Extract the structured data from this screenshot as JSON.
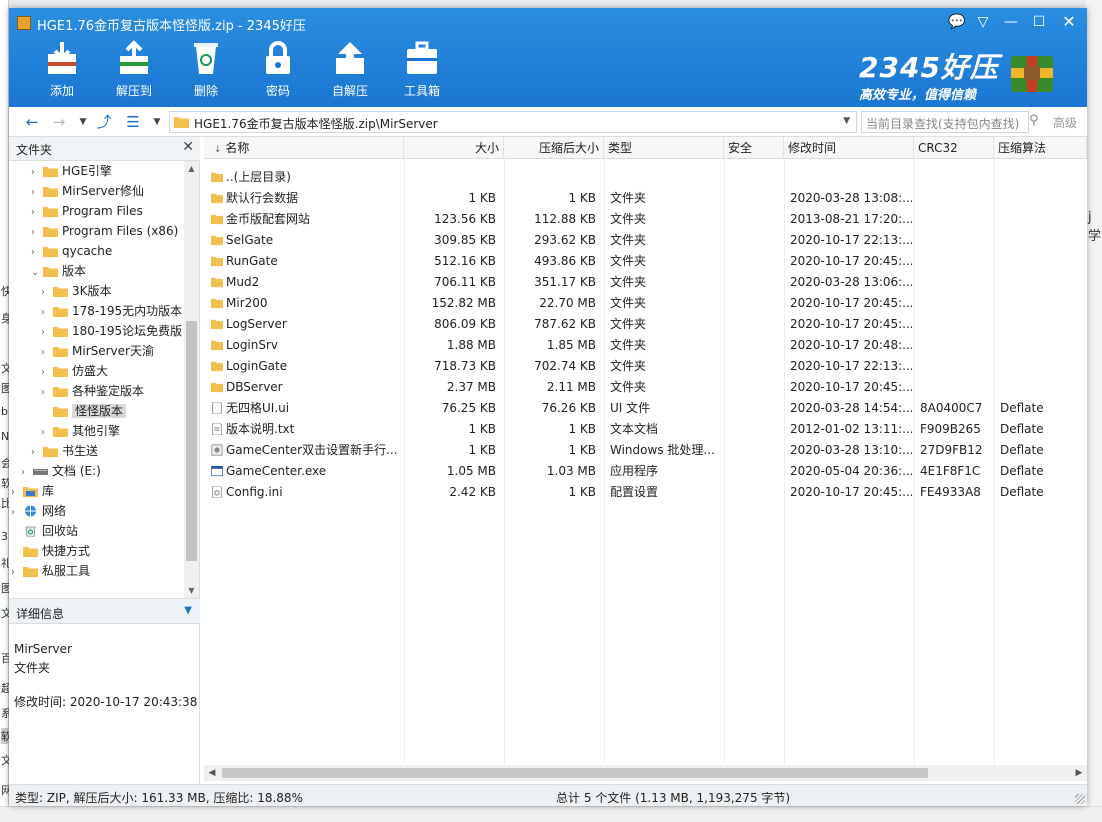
{
  "window": {
    "title": "HGE1.76金币复古版本怪怪版.zip - 2345好压",
    "controls": [
      "feedback-icon",
      "menu-icon",
      "minimize-icon",
      "maximize-icon",
      "close-icon"
    ]
  },
  "toolbar": {
    "items": [
      {
        "label": "添加",
        "icon": "add-archive-icon"
      },
      {
        "label": "解压到",
        "icon": "extract-icon"
      },
      {
        "label": "删除",
        "icon": "recycle-bin-icon"
      },
      {
        "label": "密码",
        "icon": "lock-icon"
      },
      {
        "label": "自解压",
        "icon": "self-extract-icon"
      },
      {
        "label": "工具箱",
        "icon": "toolbox-icon"
      }
    ]
  },
  "brand": {
    "name": "2345好压",
    "slogan": "高效专业，值得信赖"
  },
  "nav": {
    "path": "HGE1.76金币复古版本怪怪版.zip\\MirServer",
    "search_placeholder": "当前目录查找(支持包内查找)",
    "advanced_label": "高级"
  },
  "folder_pane": {
    "title": "文件夹",
    "items": [
      {
        "label": "HGE引擎",
        "level": 3,
        "arrow": "›"
      },
      {
        "label": "MirServer修仙",
        "level": 3,
        "arrow": "›"
      },
      {
        "label": "Program Files",
        "level": 3,
        "arrow": "›"
      },
      {
        "label": "Program Files (x86)",
        "level": 3,
        "arrow": "›"
      },
      {
        "label": "qycache",
        "level": 3,
        "arrow": "›"
      },
      {
        "label": "版本",
        "level": 3,
        "arrow": "⌄"
      },
      {
        "label": "3K版本",
        "level": 4,
        "arrow": "›"
      },
      {
        "label": "178-195无内功版本",
        "level": 4,
        "arrow": "›"
      },
      {
        "label": "180-195论坛免费版",
        "level": 4,
        "arrow": "›"
      },
      {
        "label": "MirServer天渝",
        "level": 4,
        "arrow": "›"
      },
      {
        "label": "仿盛大",
        "level": 4,
        "arrow": "›"
      },
      {
        "label": "各种鉴定版本",
        "level": 4,
        "arrow": "›"
      },
      {
        "label": "怪怪版本",
        "level": 4,
        "arrow": "",
        "selected": true
      },
      {
        "label": "其他引擎",
        "level": 4,
        "arrow": "›"
      },
      {
        "label": "书生送",
        "level": 3,
        "arrow": "›"
      },
      {
        "label": "文档 (E:)",
        "level": 2,
        "arrow": "›",
        "icon": "drive"
      },
      {
        "label": "库",
        "level": 1,
        "arrow": "›",
        "icon": "library"
      },
      {
        "label": "网络",
        "level": 1,
        "arrow": "›",
        "icon": "network"
      },
      {
        "label": "回收站",
        "level": 1,
        "arrow": "",
        "icon": "recycle"
      },
      {
        "label": "快捷方式",
        "level": 1,
        "arrow": ""
      },
      {
        "label": "私服工具",
        "level": 1,
        "arrow": "›"
      }
    ]
  },
  "details": {
    "title": "详细信息",
    "name": "MirServer",
    "type": "文件夹",
    "modified_label": "修改时间:",
    "modified_value": "2020-10-17 20:43:38"
  },
  "columns": [
    "名称",
    "大小",
    "压缩后大小",
    "类型",
    "安全",
    "修改时间",
    "CRC32",
    "压缩算法"
  ],
  "files": [
    {
      "name": "..(上层目录)",
      "size": "",
      "packed": "",
      "type": "",
      "modified": "",
      "crc": "",
      "method": "",
      "icon": "folder"
    },
    {
      "name": "默认行会数据",
      "size": "1 KB",
      "packed": "1 KB",
      "type": "文件夹",
      "modified": "2020-03-28 13:08:...",
      "crc": "",
      "method": "",
      "icon": "folder"
    },
    {
      "name": "金币版配套网站",
      "size": "123.56 KB",
      "packed": "112.88 KB",
      "type": "文件夹",
      "modified": "2013-08-21 17:20:...",
      "crc": "",
      "method": "",
      "icon": "folder"
    },
    {
      "name": "SelGate",
      "size": "309.85 KB",
      "packed": "293.62 KB",
      "type": "文件夹",
      "modified": "2020-10-17 22:13:...",
      "crc": "",
      "method": "",
      "icon": "folder"
    },
    {
      "name": "RunGate",
      "size": "512.16 KB",
      "packed": "493.86 KB",
      "type": "文件夹",
      "modified": "2020-10-17 20:45:...",
      "crc": "",
      "method": "",
      "icon": "folder"
    },
    {
      "name": "Mud2",
      "size": "706.11 KB",
      "packed": "351.17 KB",
      "type": "文件夹",
      "modified": "2020-03-28 13:06:...",
      "crc": "",
      "method": "",
      "icon": "folder"
    },
    {
      "name": "Mir200",
      "size": "152.82 MB",
      "packed": "22.70 MB",
      "type": "文件夹",
      "modified": "2020-10-17 20:45:...",
      "crc": "",
      "method": "",
      "icon": "folder"
    },
    {
      "name": "LogServer",
      "size": "806.09 KB",
      "packed": "787.62 KB",
      "type": "文件夹",
      "modified": "2020-10-17 20:45:...",
      "crc": "",
      "method": "",
      "icon": "folder"
    },
    {
      "name": "LoginSrv",
      "size": "1.88 MB",
      "packed": "1.85 MB",
      "type": "文件夹",
      "modified": "2020-10-17 20:48:...",
      "crc": "",
      "method": "",
      "icon": "folder"
    },
    {
      "name": "LoginGate",
      "size": "718.73 KB",
      "packed": "702.74 KB",
      "type": "文件夹",
      "modified": "2020-10-17 22:13:...",
      "crc": "",
      "method": "",
      "icon": "folder"
    },
    {
      "name": "DBServer",
      "size": "2.37 MB",
      "packed": "2.11 MB",
      "type": "文件夹",
      "modified": "2020-10-17 20:45:...",
      "crc": "",
      "method": "",
      "icon": "folder"
    },
    {
      "name": "无四格UI.ui",
      "size": "76.25 KB",
      "packed": "76.26 KB",
      "type": "UI 文件",
      "modified": "2020-03-28 14:54:...",
      "crc": "8A0400C7",
      "method": "Deflate",
      "icon": "file"
    },
    {
      "name": "版本说明.txt",
      "size": "1 KB",
      "packed": "1 KB",
      "type": "文本文档",
      "modified": "2012-01-02 13:11:...",
      "crc": "F909B265",
      "method": "Deflate",
      "icon": "text"
    },
    {
      "name": "GameCenter双击设置新手行...",
      "size": "1 KB",
      "packed": "1 KB",
      "type": "Windows 批处理...",
      "modified": "2020-03-28 13:10:...",
      "crc": "27D9FB12",
      "method": "Deflate",
      "icon": "batch"
    },
    {
      "name": "GameCenter.exe",
      "size": "1.05 MB",
      "packed": "1.03 MB",
      "type": "应用程序",
      "modified": "2020-05-04 20:36:...",
      "crc": "4E1F8F1C",
      "method": "Deflate",
      "icon": "exe"
    },
    {
      "name": "Config.ini",
      "size": "2.42 KB",
      "packed": "1 KB",
      "type": "配置设置",
      "modified": "2020-10-17 20:45:...",
      "crc": "FE4933A8",
      "method": "Deflate",
      "icon": "ini"
    }
  ],
  "status": {
    "left": "类型: ZIP, 解压后大小: 161.33 MB, 压缩比: 18.88%",
    "middle": "总计 5 个文件 (1.13 MB, 1,193,275 字节)"
  },
  "colors": {
    "titlebar": "#1a76d2",
    "folder": "#f2c04e",
    "accent": "#1a73c8"
  }
}
